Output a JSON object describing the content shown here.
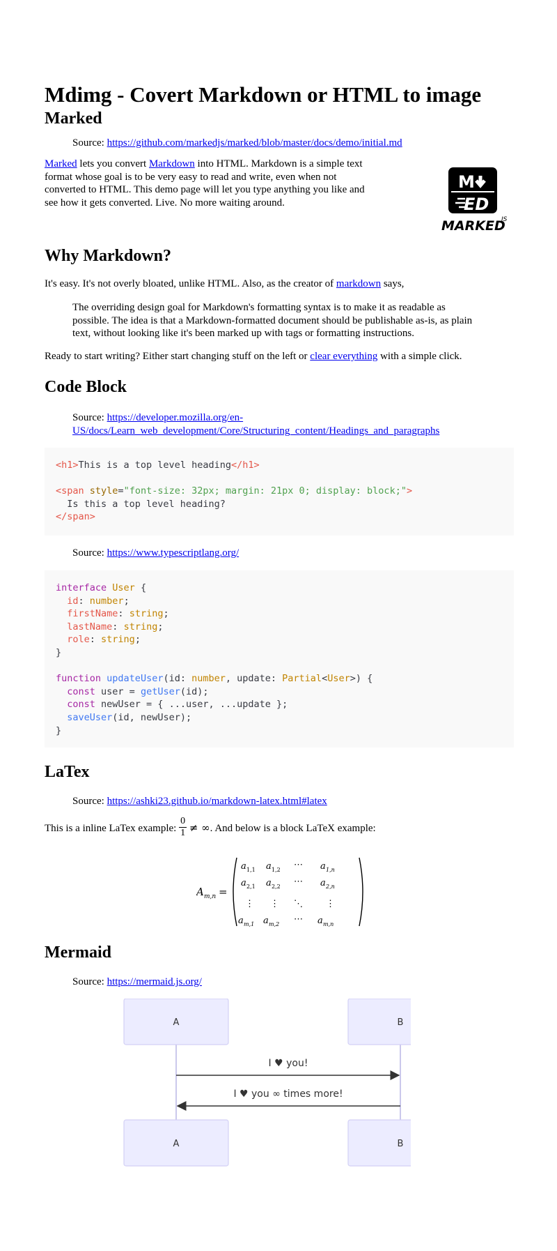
{
  "title": "Mdimg - Covert Markdown or HTML to image",
  "marked": {
    "heading": "Marked",
    "source_label": "Source: ",
    "source_link": "https://github.com/markedjs/marked/blob/master/docs/demo/initial.md",
    "intro_link1": "Marked",
    "intro_text1": " lets you convert ",
    "intro_link2": "Markdown",
    "intro_text2": " into HTML. Markdown is a simple text format whose goal is to be very easy to read and write, even when not converted to HTML. This demo page will let you type anything you like and see how it gets converted. Live. No more waiting around.",
    "logo_text": "MARKED",
    "logo_sup": "JS"
  },
  "why": {
    "heading": "Why Markdown?",
    "p1_text": "It's easy. It's not overly bloated, unlike HTML. Also, as the creator of ",
    "p1_link": "markdown",
    "p1_end": " says,",
    "quote": "The overriding design goal for Markdown's formatting syntax is to make it as readable as possible. The idea is that a Markdown-formatted document should be publishable as-is, as plain text, without looking like it's been marked up with tags or formatting instructions.",
    "p2_text": "Ready to start writing? Either start changing stuff on the left or ",
    "p2_link": "clear everything",
    "p2_end": " with a simple click."
  },
  "code": {
    "heading": "Code Block",
    "source1_label": "Source: ",
    "source1_link_l1": "https://developer.mozilla.org/en-",
    "source1_link_l2": "US/docs/Learn_web_development/Core/Structuring_content/Headings_and_paragraphs",
    "source2_label": "Source: ",
    "source2_link": "https://www.typescriptlang.org/",
    "html_lines": [
      "<h1>This is a top level heading</h1>",
      "",
      "<span style=\"font-size: 32px; margin: 21px 0; display: block;\">",
      "  Is this a top level heading?",
      "</span>"
    ],
    "ts_lines": [
      "interface User {",
      "  id: number;",
      "  firstName: string;",
      "  lastName: string;",
      "  role: string;",
      "}",
      "",
      "function updateUser(id: number, update: Partial<User>) {",
      "  const user = getUser(id);",
      "  const newUser = { ...user, ...update };",
      "  saveUser(id, newUser);",
      "}"
    ]
  },
  "latex": {
    "heading": "LaTex",
    "source_label": "Source: ",
    "source_link": "https://ashki23.github.io/markdown-latex.html#latex",
    "inline_before": "This is a inline LaTex example: ",
    "inline_after": ". And below is a block LaTeX example:",
    "frac_num": "0",
    "frac_den": "1",
    "neq_inf": "≠ ∞"
  },
  "mermaid": {
    "heading": "Mermaid",
    "source_label": "Source: ",
    "source_link": "https://mermaid.js.org/",
    "actor_a": "A",
    "actor_b": "B",
    "msg1": "I ♥ you!",
    "msg2": "I ♥ you ∞ times more!"
  }
}
